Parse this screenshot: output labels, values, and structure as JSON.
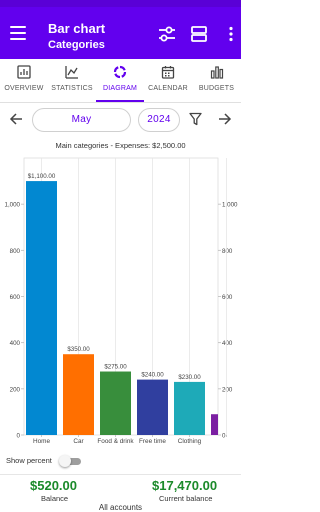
{
  "app_bar": {
    "title": "Bar chart",
    "subtitle": "Categories"
  },
  "tabs": [
    {
      "label": "OVERVIEW",
      "icon": "overview-icon"
    },
    {
      "label": "STATISTICS",
      "icon": "statistics-icon"
    },
    {
      "label": "DIAGRAM",
      "icon": "diagram-icon",
      "active": true
    },
    {
      "label": "CALENDAR",
      "icon": "calendar-icon"
    },
    {
      "label": "BUDGETS",
      "icon": "budgets-icon"
    }
  ],
  "period": {
    "month": "May",
    "year": "2024"
  },
  "colors": {
    "primary": "#6200ee",
    "income_green": "#1b8a2a"
  },
  "chart_data": {
    "type": "bar",
    "title": "Main categories - Expenses: $2,500.00",
    "categories": [
      "Home",
      "Car",
      "Food & drink",
      "Free time",
      "Clothing",
      ""
    ],
    "values": [
      1100,
      350,
      275,
      240,
      230,
      90
    ],
    "value_labels": [
      "$1,100.00",
      "$350.00",
      "$275.00",
      "$240.00",
      "$230.00",
      ""
    ],
    "bar_colors": [
      "#0288d1",
      "#ff6f00",
      "#388e3c",
      "#303f9f",
      "#1eaab8",
      "#7b1fa2"
    ],
    "y_ticks": [
      "0",
      "200",
      "400",
      "600",
      "800",
      "1,000"
    ],
    "y_tick_values": [
      0,
      200,
      400,
      600,
      800,
      1000
    ],
    "ylim": [
      0,
      1200
    ],
    "grid": true
  },
  "show_percent": {
    "label": "Show percent",
    "on": false
  },
  "footer": {
    "balance_amount": "$520.00",
    "balance_label": "Balance",
    "current_amount": "$17,470.00",
    "current_label": "Current balance",
    "accounts": "All accounts"
  }
}
